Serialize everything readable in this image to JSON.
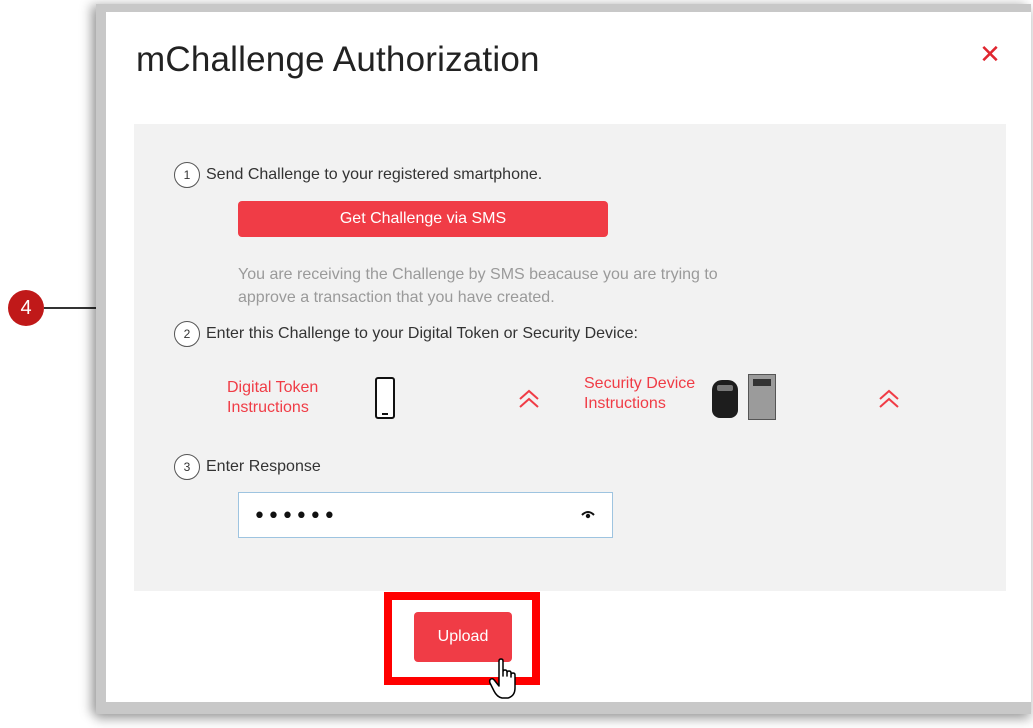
{
  "dialog": {
    "title": "mChallenge Authorization",
    "close_symbol": "✕"
  },
  "step1": {
    "number": "1",
    "text": "Send Challenge to your registered smartphone.",
    "button_label": "Get Challenge via SMS",
    "info_line1": "You are receiving the Challenge by SMS beacause you are trying to",
    "info_line2": "approve a transaction that you have created."
  },
  "step2": {
    "number": "2",
    "text": "Enter this Challenge to your Digital Token or Security Device:",
    "digital_token_line1": "Digital Token",
    "digital_token_line2": "Instructions",
    "security_device_line1": "Security Device",
    "security_device_line2": "Instructions"
  },
  "step3": {
    "number": "3",
    "text": "Enter Response",
    "response_value": "••••••"
  },
  "footer": {
    "upload_label": "Upload"
  },
  "annotation": {
    "callout_number": "4"
  },
  "icons": {
    "close": "close-icon",
    "phone": "smartphone-icon",
    "chevron": "chevron-double-up-icon",
    "security_device": "security-token-icon",
    "eye": "eye-icon",
    "cursor": "hand-pointer-icon"
  },
  "colors": {
    "accent": "#f03c46",
    "highlight": "#ff0000",
    "panel_bg": "#f2f2f2",
    "callout": "#c01919"
  }
}
